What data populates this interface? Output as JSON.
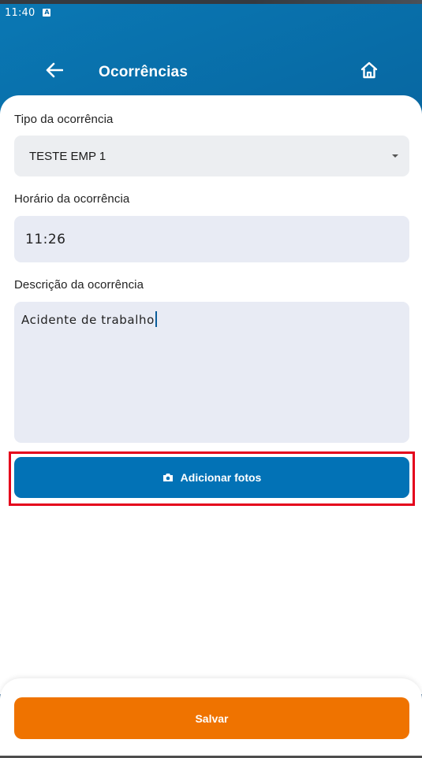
{
  "status_bar": {
    "time": "11:40",
    "notification_icon": "a-icon",
    "notification_glyph": "A"
  },
  "header": {
    "title": "Ocorrências",
    "back_icon": "arrow-left-icon",
    "home_icon": "home-icon"
  },
  "form": {
    "tipo": {
      "label": "Tipo da ocorrência",
      "value": "TESTE EMP 1"
    },
    "horario": {
      "label": "Horário da ocorrência",
      "value": "11:26"
    },
    "descricao": {
      "label": "Descrição da ocorrência",
      "value": "Acidente de trabalho"
    },
    "add_photos": {
      "label": "Adicionar fotos",
      "icon": "camera-icon"
    }
  },
  "footer": {
    "save_label": "Salvar"
  },
  "colors": {
    "header_gradient_start": "#0a78b4",
    "header_gradient_end": "#0f3f73",
    "primary_button": "#0272b6",
    "save_button": "#ef7300",
    "highlight": "#e4001b",
    "input_background": "#e8ebf4"
  }
}
